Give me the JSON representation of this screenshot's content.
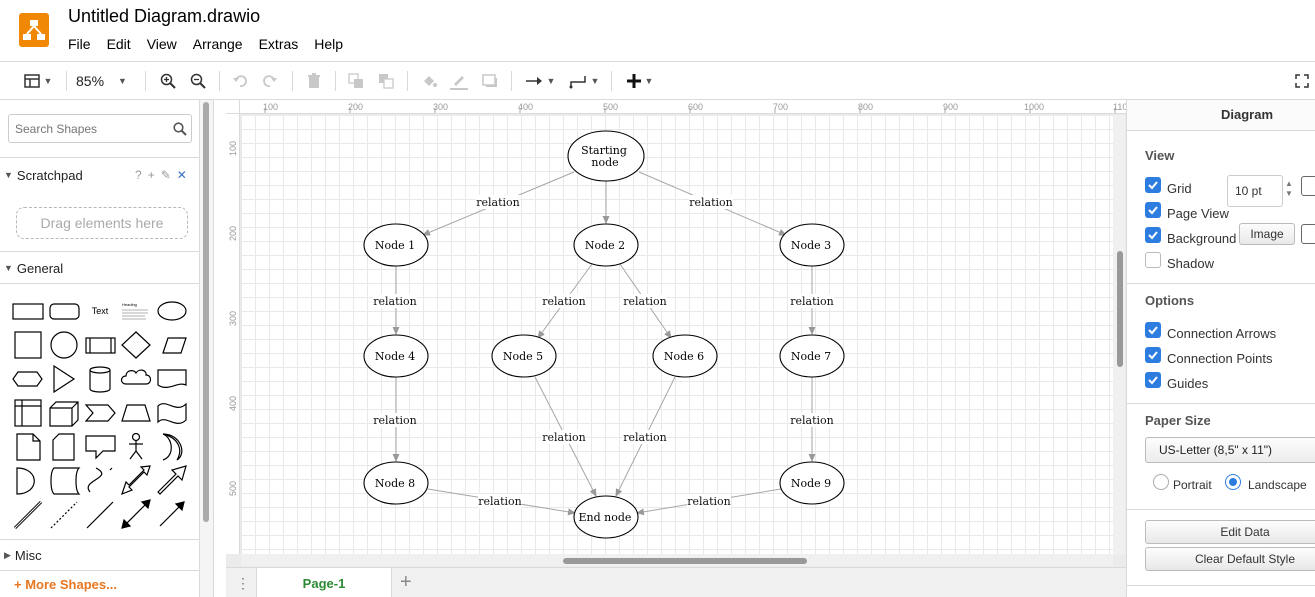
{
  "app": {
    "title": "Untitled Diagram.drawio",
    "menus": [
      "File",
      "Edit",
      "View",
      "Arrange",
      "Extras",
      "Help"
    ]
  },
  "toolbar": {
    "zoom": "85%",
    "icons": [
      "format-panel-icon",
      "zoom-in-icon",
      "zoom-out-icon",
      "undo-icon",
      "redo-icon",
      "delete-icon",
      "to-front-icon",
      "to-back-icon",
      "fill-color-icon",
      "line-color-icon",
      "shadow-icon",
      "connection-icon",
      "waypoints-icon",
      "insert-icon",
      "fullscreen-icon"
    ]
  },
  "sidebar": {
    "search_placeholder": "Search Shapes",
    "scratchpad": {
      "title": "Scratchpad",
      "dropzone": "Drag elements here"
    },
    "general": {
      "title": "General",
      "text_shape": "Text",
      "heading_shape": "Heading"
    },
    "misc": {
      "title": "Misc"
    },
    "more_shapes": "More Shapes..."
  },
  "canvas": {
    "ruler_x": [
      "100",
      "200",
      "300",
      "400",
      "500",
      "600",
      "700",
      "800",
      "900",
      "1000",
      "110"
    ],
    "ruler_y": [
      "100",
      "200",
      "300",
      "400",
      "500"
    ],
    "nodes": {
      "start": [
        "Starting",
        "node"
      ],
      "n1": "Node 1",
      "n2": "Node 2",
      "n3": "Node 3",
      "n4": "Node 4",
      "n5": "Node 5",
      "n6": "Node 6",
      "n7": "Node 7",
      "n8": "Node 8",
      "n9": "Node 9",
      "end": "End node"
    },
    "edge_label": "relation"
  },
  "pages": {
    "tabs": [
      {
        "label": "Page-1",
        "active": true
      }
    ],
    "add_label": "+"
  },
  "format_panel": {
    "title": "Diagram",
    "view": {
      "title": "View",
      "grid": {
        "label": "Grid",
        "checked": true
      },
      "grid_size": "10 pt",
      "page_view": {
        "label": "Page View",
        "checked": true
      },
      "background": {
        "label": "Background",
        "checked": true
      },
      "image_button": "Image",
      "shadow": {
        "label": "Shadow",
        "checked": false
      }
    },
    "options": {
      "title": "Options",
      "connection_arrows": {
        "label": "Connection Arrows",
        "checked": true
      },
      "connection_points": {
        "label": "Connection Points",
        "checked": true
      },
      "guides": {
        "label": "Guides",
        "checked": true
      }
    },
    "paper_size": {
      "title": "Paper Size",
      "selected": "US-Letter (8,5\" x 11\")",
      "portrait": "Portrait",
      "landscape": "Landscape",
      "orientation": "landscape"
    },
    "edit_data": "Edit Data",
    "clear_default_style": "Clear Default Style"
  },
  "colors": {
    "accent": "#2d7de0",
    "logo": "#f08705",
    "page_tab": "#2d8a34",
    "more_shapes": "#e87722"
  }
}
